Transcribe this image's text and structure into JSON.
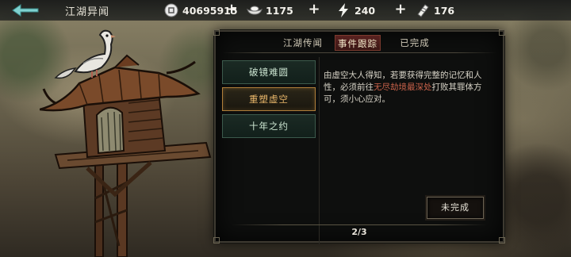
{
  "header": {
    "title": "江湖异闻",
    "resources": [
      {
        "icon": "coin-icon",
        "value": "40695915"
      },
      {
        "icon": "silver-ingot-icon",
        "value": "1175"
      },
      {
        "icon": "lightning-icon",
        "value": "240"
      },
      {
        "icon": "ticket-icon",
        "value": "176"
      }
    ],
    "plus_label": "+"
  },
  "tabs": [
    {
      "label": "江湖传闻",
      "active": false
    },
    {
      "label": "事件跟踪",
      "active": true
    },
    {
      "label": "已完成",
      "active": false
    }
  ],
  "events": [
    {
      "label": "破镜难圆",
      "selected": false
    },
    {
      "label": "重塑虚空",
      "selected": true
    },
    {
      "label": "十年之约",
      "selected": false
    }
  ],
  "description": {
    "before": "由虚空大人得知，若要获得完整的记忆和人性，必须前往",
    "highlight": "无尽劫境最深处",
    "after": "打败其罪体方可，须小心应对。"
  },
  "status_button": "未完成",
  "pager": "2/3",
  "colors": {
    "highlight": "#c9624a",
    "selected_gold": "#e8b66a",
    "active_tab": "#5a2220"
  }
}
